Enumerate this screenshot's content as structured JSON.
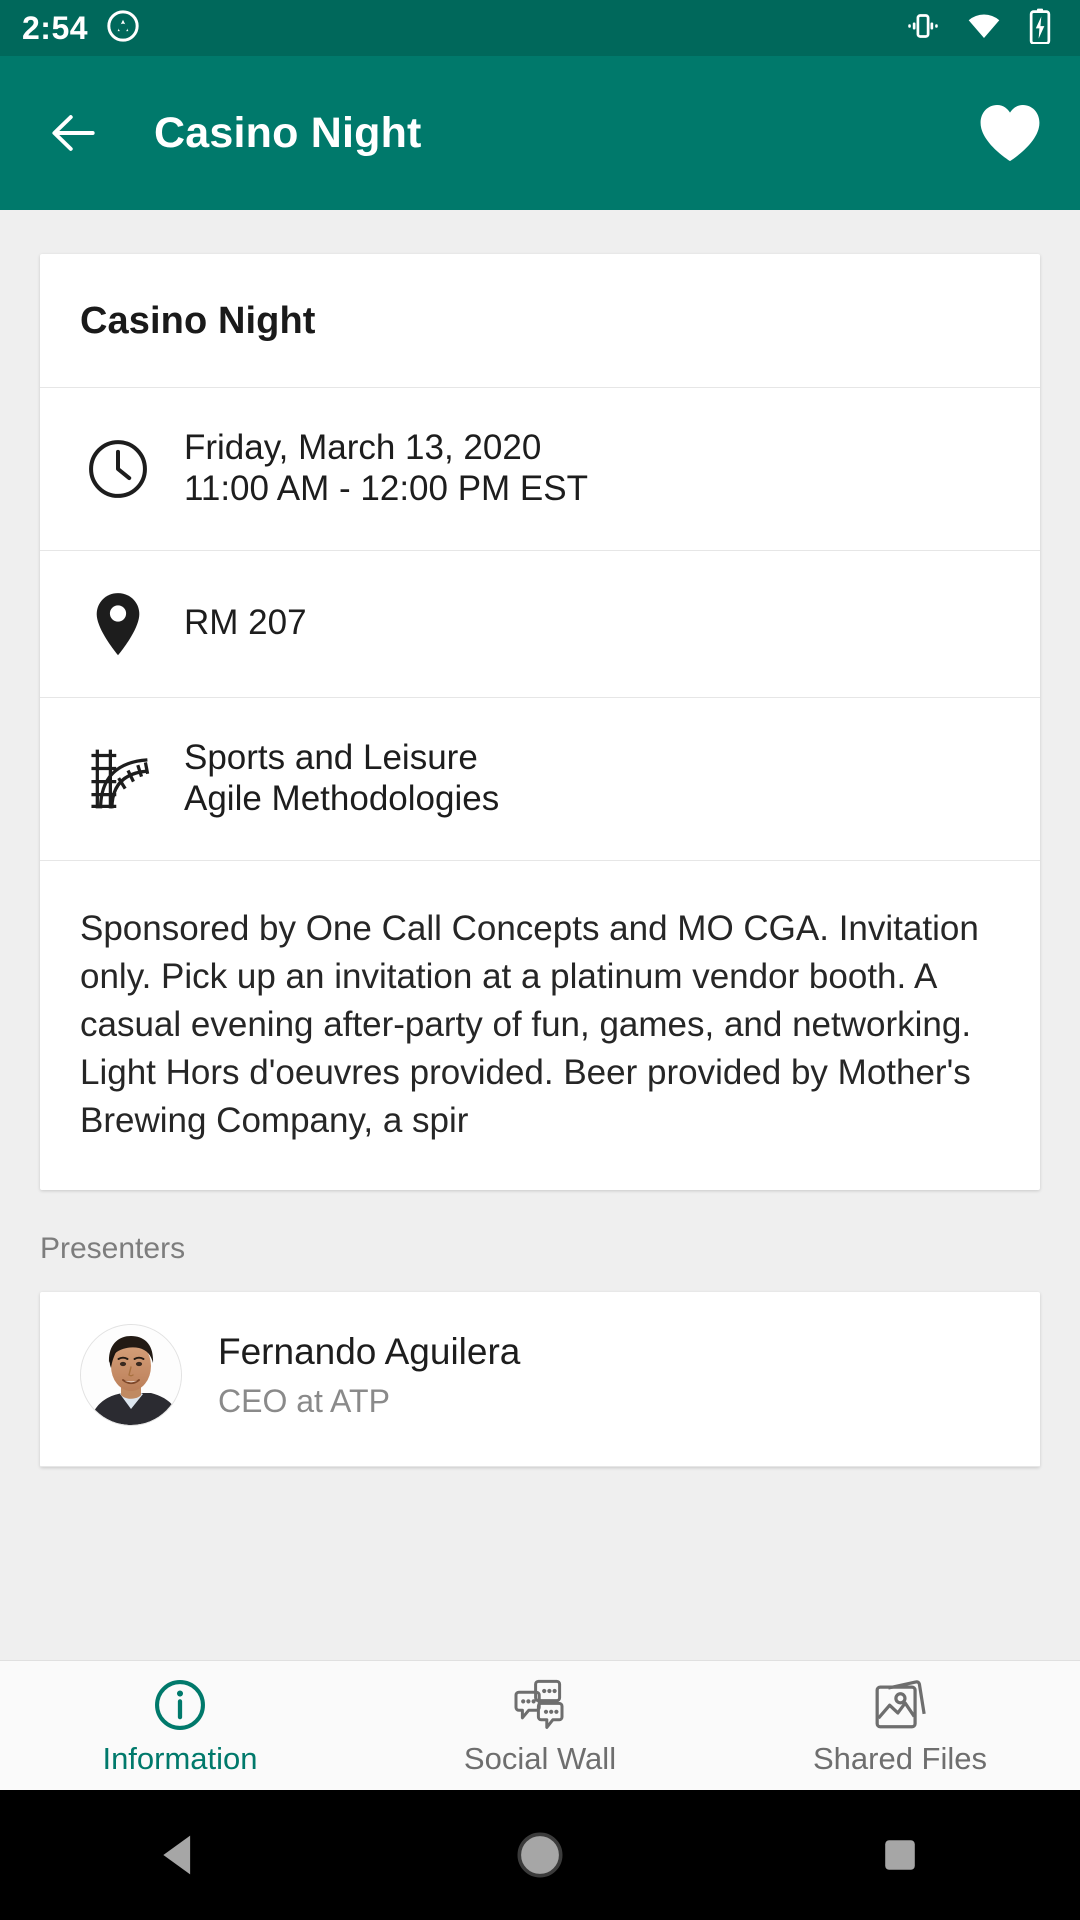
{
  "status_bar": {
    "time": "2:54",
    "icons": [
      "screenshot-capture-icon",
      "vibrate-icon",
      "wifi-icon",
      "battery-charging-icon"
    ],
    "background_color": "#00685b"
  },
  "app_bar": {
    "title": "Casino Night",
    "back_icon": "arrow-back-icon",
    "favorite_icon": "heart-filled-icon",
    "background_color": "#00796b",
    "text_color": "#ffffff"
  },
  "event": {
    "title": "Casino Night",
    "datetime": {
      "icon": "clock-icon",
      "date": "Friday, March 13, 2020",
      "time_range": "11:00 AM - 12:00 PM EST"
    },
    "location": {
      "icon": "map-pin-icon",
      "room": "RM 207"
    },
    "track": {
      "icon": "railroad-track-icon",
      "category": "Sports and Leisure",
      "subcategory": "Agile Methodologies"
    },
    "description": "Sponsored by One Call Concepts and MO CGA. Invitation only. Pick up an invitation at a platinum vendor booth. A casual evening after-party of fun, games, and networking. Light Hors d'oeuvres provided. Beer provided by Mother's Brewing Company, a spir"
  },
  "presenters": {
    "section_label": "Presenters",
    "items": [
      {
        "name": "Fernando Aguilera",
        "role": "CEO at ATP",
        "avatar": "presenter-photo"
      }
    ]
  },
  "bottom_tabs": {
    "active_index": 0,
    "active_color": "#00796b",
    "inactive_color": "#6e6e6e",
    "items": [
      {
        "label": "Information",
        "icon": "info-circle-icon"
      },
      {
        "label": "Social Wall",
        "icon": "chat-bubbles-icon"
      },
      {
        "label": "Shared Files",
        "icon": "photo-stack-icon"
      }
    ]
  },
  "android_nav": {
    "buttons": [
      {
        "name": "back",
        "icon": "triangle-back-icon"
      },
      {
        "name": "home",
        "icon": "circle-home-icon"
      },
      {
        "name": "recents",
        "icon": "square-recents-icon"
      }
    ]
  }
}
